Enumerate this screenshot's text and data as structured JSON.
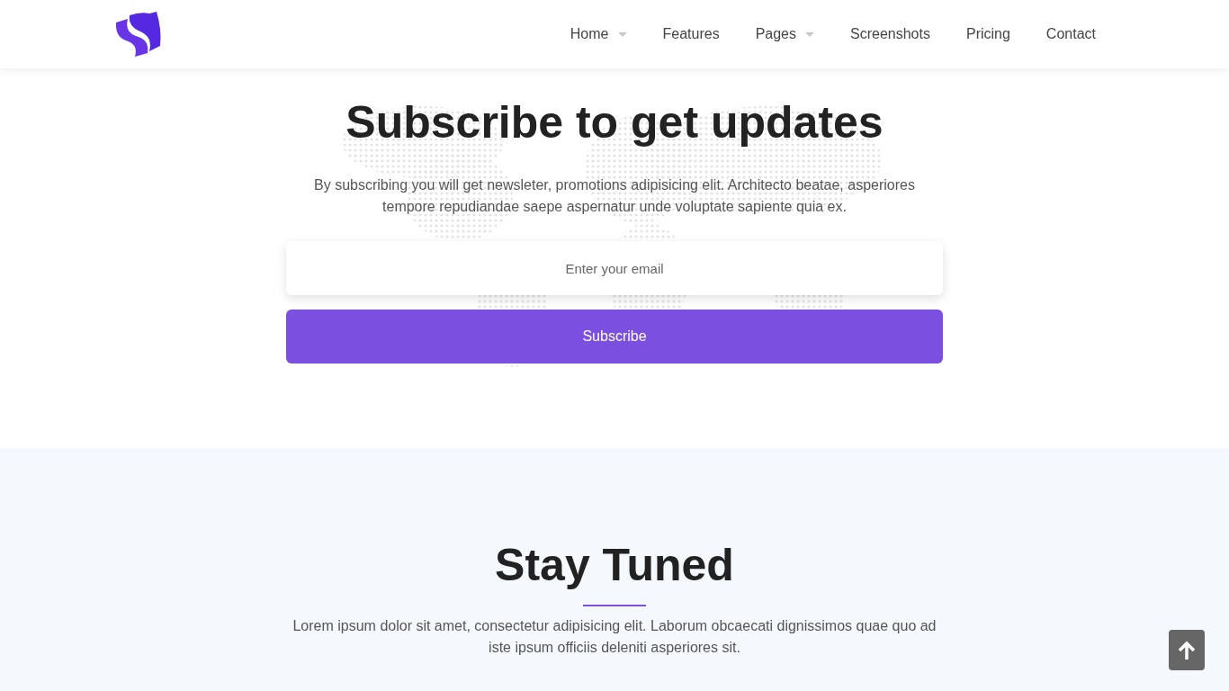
{
  "nav": {
    "items": [
      {
        "label": "Home",
        "has_dropdown": true
      },
      {
        "label": "Features",
        "has_dropdown": false
      },
      {
        "label": "Pages",
        "has_dropdown": true
      },
      {
        "label": "Screenshots",
        "has_dropdown": false
      },
      {
        "label": "Pricing",
        "has_dropdown": false
      },
      {
        "label": "Contact",
        "has_dropdown": false
      }
    ]
  },
  "subscribe": {
    "title": "Subscribe to get updates",
    "text": "By subscribing you will get newsleter, promotions adipisicing elit. Architecto beatae, asperiores tempore repudiandae saepe aspernatur unde voluptate sapiente quia ex.",
    "email": {
      "placeholder": "Enter your email"
    },
    "button": "Subscribe"
  },
  "stay_tuned": {
    "title": "Stay Tuned",
    "text": "Lorem ipsum dolor sit amet, consectetur adipisicing elit. Laborum obcaecati dignissimos quae quo ad iste ipsum officiis deleniti asperiores sit."
  }
}
